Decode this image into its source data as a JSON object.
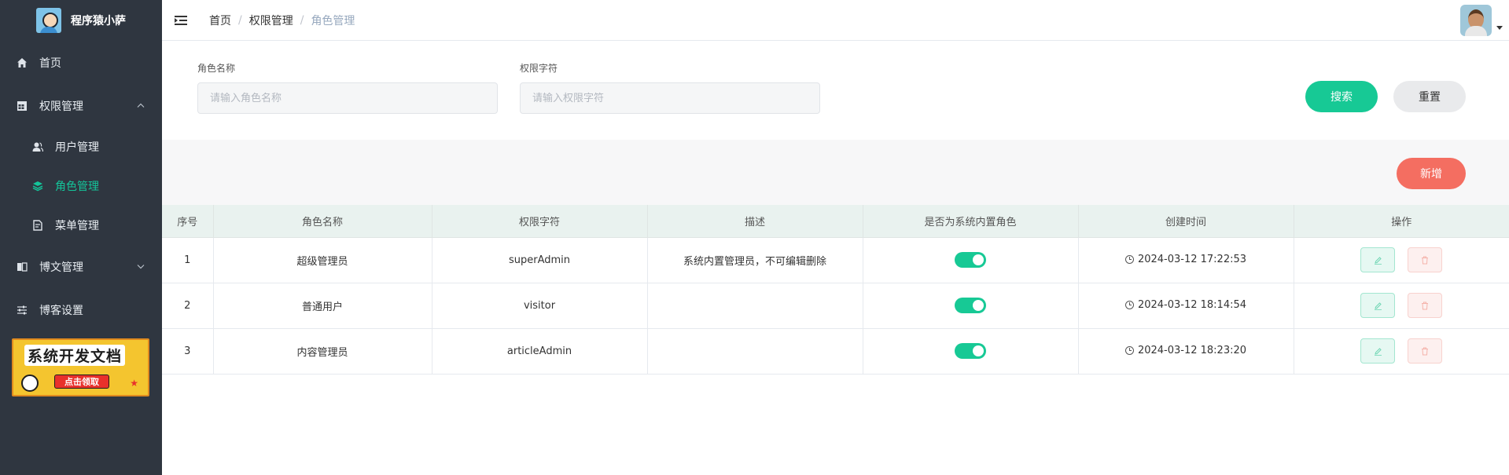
{
  "sidebar": {
    "brand_title": "程序猿小萨",
    "items": [
      {
        "label": "首页",
        "icon": "home-icon"
      },
      {
        "label": "权限管理",
        "icon": "grid-icon",
        "expanded": true
      },
      {
        "label": "用户管理",
        "icon": "users-icon"
      },
      {
        "label": "角色管理",
        "icon": "layers-icon",
        "active": true
      },
      {
        "label": "菜单管理",
        "icon": "document-icon"
      },
      {
        "label": "博文管理",
        "icon": "book-icon",
        "expanded": false
      },
      {
        "label": "博客设置",
        "icon": "sliders-icon"
      }
    ],
    "banner": {
      "title": "系统开发文档",
      "button": "点击领取"
    }
  },
  "header": {
    "breadcrumb": [
      "首页",
      "权限管理",
      "角色管理"
    ]
  },
  "search": {
    "role_name_label": "角色名称",
    "role_name_placeholder": "请输入角色名称",
    "role_name_value": "",
    "permission_label": "权限字符",
    "permission_placeholder": "请输入权限字符",
    "permission_value": "",
    "search_button": "搜索",
    "reset_button": "重置"
  },
  "toolbar": {
    "add_button": "新增"
  },
  "table": {
    "columns": [
      "序号",
      "角色名称",
      "权限字符",
      "描述",
      "是否为系统内置角色",
      "创建时间",
      "操作"
    ],
    "rows": [
      {
        "index": "1",
        "name": "超级管理员",
        "code": "superAdmin",
        "desc": "系统内置管理员，不可编辑删除",
        "builtin": true,
        "created": "2024-03-12 17:22:53"
      },
      {
        "index": "2",
        "name": "普通用户",
        "code": "visitor",
        "desc": "",
        "builtin": true,
        "created": "2024-03-12 18:14:54"
      },
      {
        "index": "3",
        "name": "内容管理员",
        "code": "articleAdmin",
        "desc": "",
        "builtin": true,
        "created": "2024-03-12 18:23:20"
      }
    ]
  },
  "colors": {
    "sidebar_bg": "#2f3640",
    "accent": "#17c995",
    "danger": "#f46e61",
    "header_row": "#e9f2ef"
  }
}
